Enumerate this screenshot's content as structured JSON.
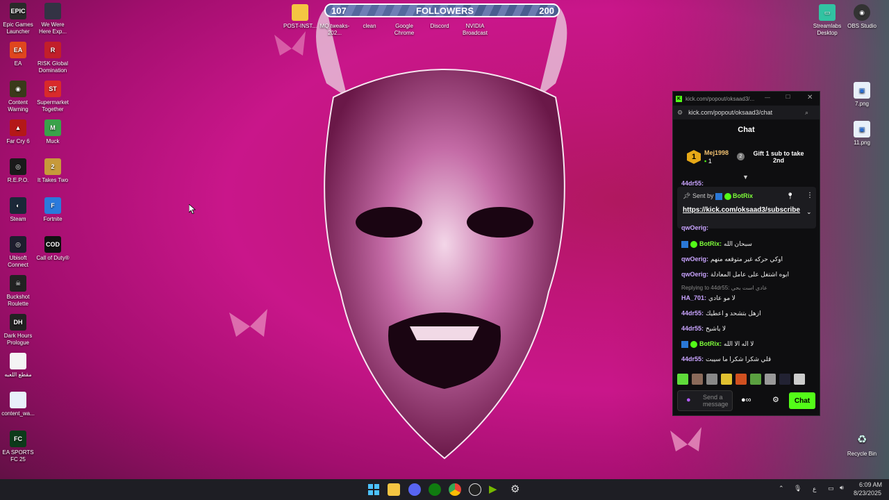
{
  "desktop": {
    "left_icons": [
      {
        "label": "Epic Games Launcher",
        "icon": "epic-icon",
        "color": "#2a2a2a",
        "glyph": "EPIC"
      },
      {
        "label": "We Were Here Exp...",
        "icon": "game-icon",
        "color": "#334",
        "glyph": ""
      },
      {
        "label": "EA",
        "icon": "ea-icon",
        "color": "#e0461e",
        "glyph": "EA"
      },
      {
        "label": "RISK Global Domination",
        "icon": "risk-icon",
        "color": "#c21f2a",
        "glyph": "R"
      },
      {
        "label": "Content Warning",
        "icon": "content-warning-icon",
        "color": "#3a3a1a",
        "glyph": "◉"
      },
      {
        "label": "Supermarket Together",
        "icon": "supermarket-icon",
        "color": "#d92a2a",
        "glyph": "ST"
      },
      {
        "label": "Far Cry 6",
        "icon": "farcry-icon",
        "color": "#b41818",
        "glyph": "▲"
      },
      {
        "label": "Muck",
        "icon": "muck-icon",
        "color": "#3aa24a",
        "glyph": "M"
      },
      {
        "label": "R.E.P.O.",
        "icon": "repo-icon",
        "color": "#1a1a1a",
        "glyph": "◎"
      },
      {
        "label": "It Takes Two",
        "icon": "it-takes-two-icon",
        "color": "#c79a3a",
        "glyph": "2"
      },
      {
        "label": "Steam",
        "icon": "steam-icon",
        "color": "#1b2838",
        "glyph": "◐"
      },
      {
        "label": "Fortnite",
        "icon": "fortnite-icon",
        "color": "#2a7adc",
        "glyph": "F"
      },
      {
        "label": "Ubisoft Connect",
        "icon": "ubisoft-icon",
        "color": "#1e1e2e",
        "glyph": "◎"
      },
      {
        "label": "Call of Duty®",
        "icon": "cod-icon",
        "color": "#111",
        "glyph": "COD"
      },
      {
        "label": "Buckshot Roulette",
        "icon": "buckshot-icon",
        "color": "#222",
        "glyph": "☠"
      },
      {
        "label": "Dark Hours Prologue",
        "icon": "dark-hours-icon",
        "color": "#222",
        "glyph": "DH"
      },
      {
        "label": "مقطع اللعبه",
        "icon": "file-icon",
        "color": "#f4f4f4",
        "glyph": ""
      },
      {
        "label": "content_wa...",
        "icon": "image-file-icon",
        "color": "#e8f0fa",
        "glyph": ""
      },
      {
        "label": "EA SPORTS FC 25",
        "icon": "ea-fc-icon",
        "color": "#0d3a1a",
        "glyph": "FC"
      }
    ],
    "top_icons": [
      {
        "label": "POST-INST...",
        "icon": "folder-icon"
      },
      {
        "label": "MQ tweaks-202...",
        "icon": "file-icon"
      },
      {
        "label": "clean",
        "icon": "file-icon"
      },
      {
        "label": "Google Chrome",
        "icon": "chrome-icon"
      },
      {
        "label": "Discord",
        "icon": "discord-icon"
      },
      {
        "label": "NVIDIA Broadcast",
        "icon": "nvidia-icon"
      }
    ],
    "right_icons": [
      {
        "label": "Streamlabs Desktop",
        "icon": "streamlabs-icon"
      },
      {
        "label": "OBS Studio",
        "icon": "obs-icon"
      },
      {
        "label": "7.png",
        "icon": "image-file-icon"
      },
      {
        "label": "11.png",
        "icon": "image-file-icon"
      },
      {
        "label": "Recycle Bin",
        "icon": "recycle-bin-icon"
      }
    ]
  },
  "followers_bar": {
    "current": "107",
    "label": "FOLLOWERS",
    "goal": "200",
    "progress": 0.6
  },
  "chat": {
    "window_title": "kick.com/popout/oksaad3/...",
    "url": "kick.com/popout/oksaad3/chat",
    "header": "Chat",
    "leaderboard": {
      "rank": "1",
      "user": "Mej1998",
      "count": "1",
      "gift_rank": "2",
      "gift_text": "Gift 1 sub to take 2nd"
    },
    "pinned": {
      "sent_by_label": "Sent by",
      "sender": "BotRix",
      "link": "https://kick.com/oksaad3/subscribe"
    },
    "partial_top": "44dr55:",
    "partial_qw": "qwOerig:",
    "messages": [
      {
        "user": "BotRix:",
        "text": "سبحان الله",
        "color": "#7fff3a",
        "bot": true
      },
      {
        "user": "qwOerig:",
        "text": "اوكي حركه غير متوقعه منهم",
        "color": "#c9a4ff",
        "bot": false
      },
      {
        "user": "qwOerig:",
        "text": "ابوه اشتغل على عامل المعادلة",
        "color": "#c9a4ff",
        "bot": false
      },
      {
        "user": "HA_701:",
        "text": "لا مو عادي",
        "color": "#c9a4ff",
        "bot": false,
        "reply": "Replying to 44dr55: عادي است بحي"
      },
      {
        "user": "44dr55:",
        "text": "ازهل بتشحد و اعطيك",
        "color": "#c9a4ff",
        "bot": false
      },
      {
        "user": "44dr55:",
        "text": "لا ياشيخ",
        "color": "#c9a4ff",
        "bot": false
      },
      {
        "user": "BotRix:",
        "text": "لا اله الا الله",
        "color": "#7fff3a",
        "bot": true
      },
      {
        "user": "44dr55:",
        "text": "قلي شكرا شكرا ما سيبت",
        "color": "#c9a4ff",
        "bot": false
      }
    ],
    "input_placeholder": "Send a message",
    "chat_button": "Chat"
  },
  "taskbar": {
    "time": "6:09 AM",
    "date": "8/23/2025",
    "lang": "ع"
  }
}
